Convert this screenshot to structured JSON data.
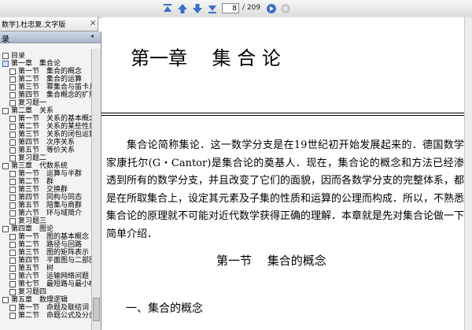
{
  "toolbar": {
    "current_page": "8",
    "total_pages": "/ 209",
    "icons": [
      "first-page-icon",
      "previous-page-icon",
      "next-page-icon",
      "last-page-icon",
      "go-icon",
      "stop-icon"
    ],
    "accent_color": "#3a6fc4"
  },
  "document_tab": {
    "label": "数学].杜忠复.文字版",
    "close_glyph": "×"
  },
  "sidebar": {
    "title": "录",
    "collapse_glyph": "◂",
    "tree": [
      {
        "label": "目录",
        "level": 0
      },
      {
        "label": "第一章　集合论",
        "level": 0,
        "expanded": true
      },
      {
        "label": "第一节　集合的概念",
        "level": 1
      },
      {
        "label": "第二节　集合的运算",
        "level": 1
      },
      {
        "label": "第三节　幂集合与笛卡儿积",
        "level": 1
      },
      {
        "label": "第四节　集合概念的扩展",
        "level": 1
      },
      {
        "label": "复习题一",
        "level": 1
      },
      {
        "label": "第二章　关系",
        "level": 0
      },
      {
        "label": "第一节　关系的基本概念",
        "level": 1
      },
      {
        "label": "第二节　关系的某些性质",
        "level": 1
      },
      {
        "label": "第三节　关系的闭包运算",
        "level": 1
      },
      {
        "label": "第四节　次序关系",
        "level": 1
      },
      {
        "label": "第五节　等价关系",
        "level": 1
      },
      {
        "label": "复习题二",
        "level": 1
      },
      {
        "label": "第三章　代数系统",
        "level": 0
      },
      {
        "label": "第一节　运算与半群",
        "level": 1
      },
      {
        "label": "第二节　群",
        "level": 1
      },
      {
        "label": "第三节　交换群",
        "level": 1
      },
      {
        "label": "第四节　同构与同态",
        "level": 1
      },
      {
        "label": "第五节　陪集与商群",
        "level": 1
      },
      {
        "label": "第六节　环与域简介",
        "level": 1
      },
      {
        "label": "复习题三",
        "level": 1
      },
      {
        "label": "第四章　图论",
        "level": 0
      },
      {
        "label": "第一节　图的基本概念",
        "level": 1
      },
      {
        "label": "第二节　路径与回路",
        "level": 1
      },
      {
        "label": "第三节　图的矩阵表示",
        "level": 1
      },
      {
        "label": "第四节　平面图与二部图",
        "level": 1
      },
      {
        "label": "第五节　树",
        "level": 1
      },
      {
        "label": "第六节　运输网络问题",
        "level": 1
      },
      {
        "label": "第七节　最短路与最小树",
        "level": 1
      },
      {
        "label": "复习题四",
        "level": 1
      },
      {
        "label": "第五章　数理逻辑",
        "level": 0
      },
      {
        "label": "第一节　命题及联结词",
        "level": 1
      },
      {
        "label": "第二节　命题公式及分类",
        "level": 1
      }
    ]
  },
  "document": {
    "chapter_title": "第一章　 集 合 论",
    "paragraph": "集合论简称集论．这一数学分支是在19世纪初开始发展起来的．德国数学家康托尔(G・Cantor)是集合论的奠基人．现在，集合论的概念和方法已经渗透到所有的数学分支，并且改变了它们的面貌，因而各数学分支的完整体系，都是在所取集合上，设定其元素及子集的性质和运算的公理而构成．所以，不熟悉集合论的原理就不可能对近代数学获得正确的理解．本章就是先对集合论做一下简单介绍．",
    "section_title": "第一节　 集合的概念",
    "subsection_title": "一、集合的概念"
  }
}
